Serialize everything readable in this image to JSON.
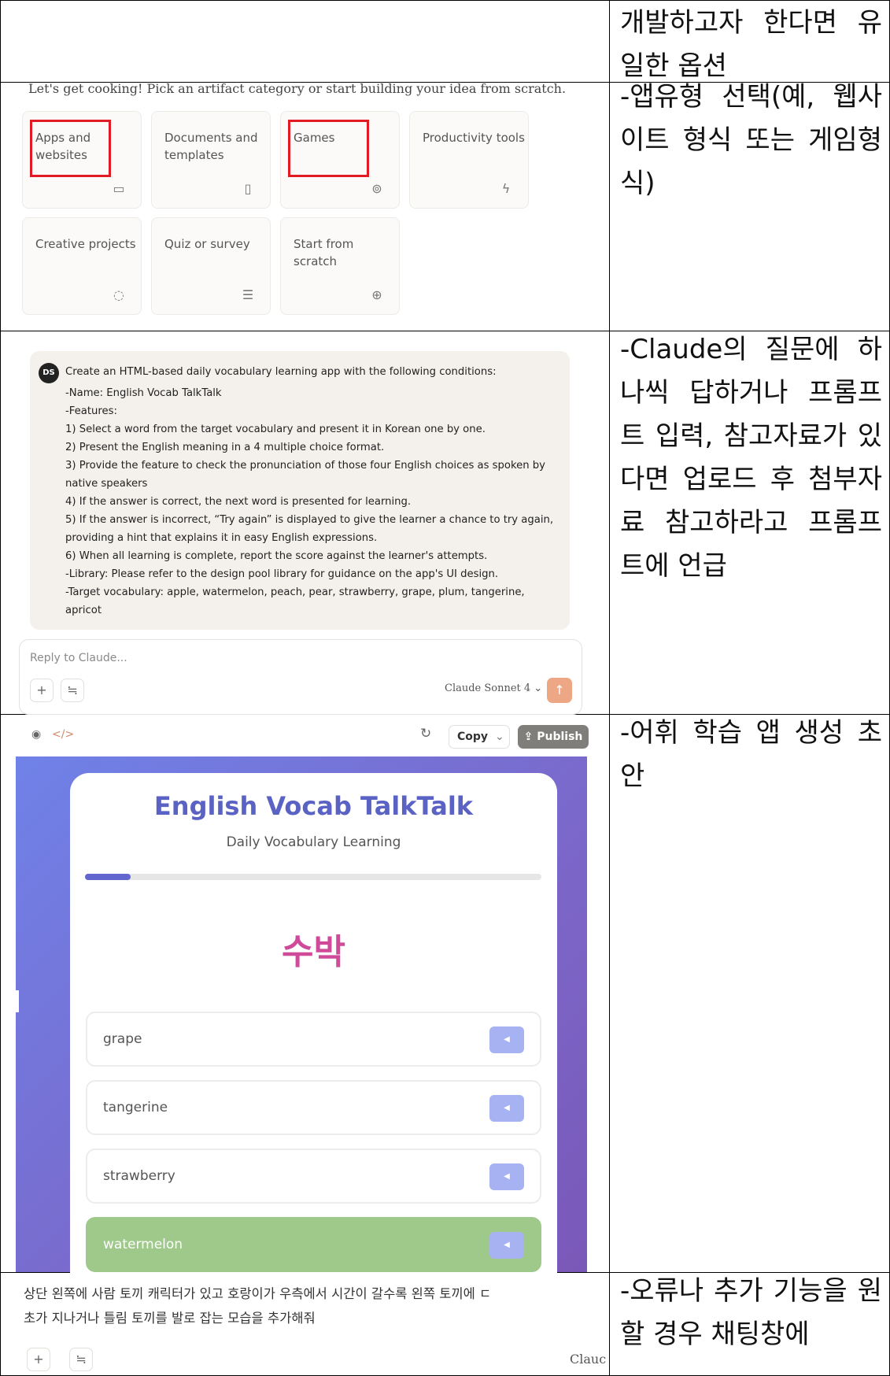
{
  "cells": {
    "r1_right": "개발하고자 한다면 유일한 옵션",
    "r2_right": "-앱유형 선택(예, 웹사이트 형식 또는 게임형식)",
    "r3_right": "-Claude의 질문에 하나씩 답하거나 프롬프트 입력, 참고자료가 있다면 업로드 후 첨부자료 참고하라고 프롬프트에 언급",
    "r4_right": "-어휘 학습 앱 생성 초안",
    "r5_right": "-오류나 추가 기능을 원할 경우 채팅창에"
  },
  "categories": {
    "intro": "Let's get cooking! Pick an artifact category or start building your idea from scratch.",
    "items": [
      {
        "label": "Apps and websites",
        "icon": "browser-icon",
        "highlighted": true
      },
      {
        "label": "Documents and templates",
        "icon": "document-icon",
        "highlighted": false
      },
      {
        "label": "Games",
        "icon": "gamepad-icon",
        "highlighted": true
      },
      {
        "label": "Productivity tools",
        "icon": "lightning-icon",
        "highlighted": false
      },
      {
        "label": "Creative projects",
        "icon": "palette-icon",
        "highlighted": false
      },
      {
        "label": "Quiz or survey",
        "icon": "form-icon",
        "highlighted": false
      },
      {
        "label": "Start from scratch",
        "icon": "plus-circle-icon",
        "highlighted": false
      }
    ],
    "highlight_color": "#e01b24"
  },
  "chat": {
    "avatar_initials": "DS",
    "message_lines": [
      "Create an HTML-based daily vocabulary learning app with the following conditions:",
      "-Name: English Vocab TalkTalk",
      "-Features:",
      "1) Select a word from the target vocabulary and present it in Korean one by one.",
      "2) Present the English meaning in a 4 multiple choice format.",
      "3) Provide the feature to check the pronunciation of those four English choices as spoken by",
      "native speakers",
      "4) If the answer is correct, the next word is presented for learning.",
      "5) If the answer is incorrect, “Try again” is displayed to give the learner a chance to try again,",
      "providing a hint that explains it in easy English expressions.",
      "6) When all learning is complete, report the score against the learner's attempts.",
      "-Library: Please refer to the design pool library for guidance on the app's UI design.",
      "-Target vocabulary: apple, watermelon, peach, pear, strawberry, grape, plum, tangerine,",
      "apricot"
    ],
    "reply_placeholder": "Reply to Claude...",
    "model_label": "Claude Sonnet 4 ⌄",
    "send_color": "#eda784"
  },
  "artifact": {
    "toolbar": {
      "copy_label": "Copy",
      "publish_label": "Publish"
    },
    "app": {
      "title": "English Vocab TalkTalk",
      "subtitle": "Daily Vocabulary Learning",
      "progress": 0.1,
      "word": "수박",
      "choices": [
        {
          "label": "grape",
          "correct": false
        },
        {
          "label": "tangerine",
          "correct": false
        },
        {
          "label": "strawberry",
          "correct": false
        },
        {
          "label": "watermelon",
          "correct": true
        }
      ],
      "title_color": "#5a62c4",
      "word_color": "#d04a9a",
      "correct_color": "#9ec98a"
    }
  },
  "followup": {
    "line1": "상단 왼쪽에 사람 토끼 캐릭터가 있고 호랑이가 우측에서 시간이 갈수록 왼쪽 토끼에 ㄷ",
    "line2": "초가 지나거나 틀림 토끼를 발로 잡는 모습을 추가해줘",
    "model_partial": "Clauc"
  }
}
